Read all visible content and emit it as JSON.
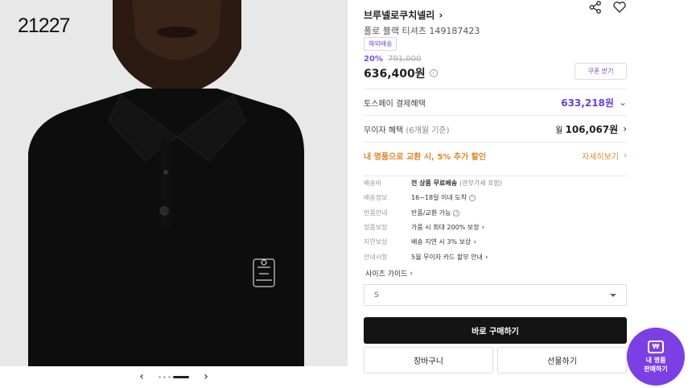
{
  "image": {
    "watermark": "21227",
    "carousel": {
      "total_dots": 4,
      "active_index": 3,
      "prev_icon": "chevron-left-icon",
      "next_icon": "chevron-right-icon"
    }
  },
  "product": {
    "brand": "브루넬로쿠치넬리",
    "name": "폴로 블랙 티셔츠 149187423",
    "badge": "해외배송",
    "discount_pct": "20%",
    "original_price": "791,000",
    "price": "636,400원",
    "coupon_label": "쿠폰 받기",
    "share_icon": "share-icon",
    "wishlist_icon": "heart-icon"
  },
  "benefits": {
    "toss": {
      "label": "토스페이 결제혜택",
      "value": "633,218원"
    },
    "no_interest": {
      "label": "무이자 혜택",
      "label_sub": "(6개월 기준)",
      "prefix": "월",
      "value": "106,067원"
    },
    "exchange": {
      "label": "내 명품으로 교환 시, 5% 추가 할인",
      "link": "자세히보기"
    }
  },
  "details": [
    {
      "key": "배송비",
      "value": "전 상품 무료배송",
      "note": "(관부가세 포함)",
      "bold": true
    },
    {
      "key": "배송정보",
      "value": "16~18일 이내 도착",
      "info": true
    },
    {
      "key": "반품안내",
      "value": "반품/교환 가능",
      "info": true
    },
    {
      "key": "정품보장",
      "value": "가품 시 최대 200% 보장",
      "chevron": true
    },
    {
      "key": "지연보상",
      "value": "배송 지연 시 3% 보상",
      "chevron": true
    },
    {
      "key": "안내사항",
      "value": "5월 무이자 카드 할부 안내",
      "chevron": true
    }
  ],
  "size_guide": "사이즈 가이드",
  "size_select": {
    "value": "S"
  },
  "actions": {
    "buy": "바로 구매하기",
    "cart": "장바구니",
    "gift": "선물하기"
  },
  "fab": {
    "line1": "내 명품",
    "line2": "판매하기"
  },
  "colors": {
    "accent": "#7b3fe4",
    "exchange": "#e0852a",
    "buy_bg": "#141414"
  }
}
